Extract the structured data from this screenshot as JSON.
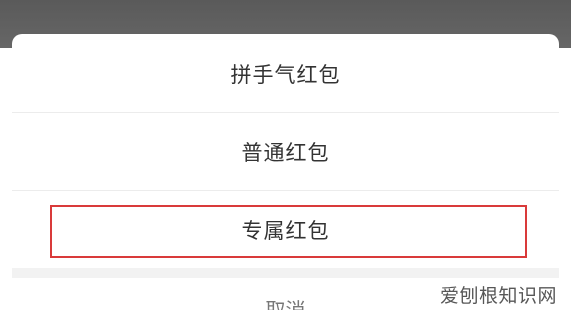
{
  "menu": {
    "items": [
      {
        "label": "拼手气红包"
      },
      {
        "label": "普通红包"
      },
      {
        "label": "专属红包"
      }
    ],
    "cancel_label": "取消"
  },
  "watermark": {
    "text": "爱刨根知识网"
  },
  "colors": {
    "highlight_border": "#d93a3a",
    "backdrop": "#5e5e5e",
    "text": "#333333"
  }
}
